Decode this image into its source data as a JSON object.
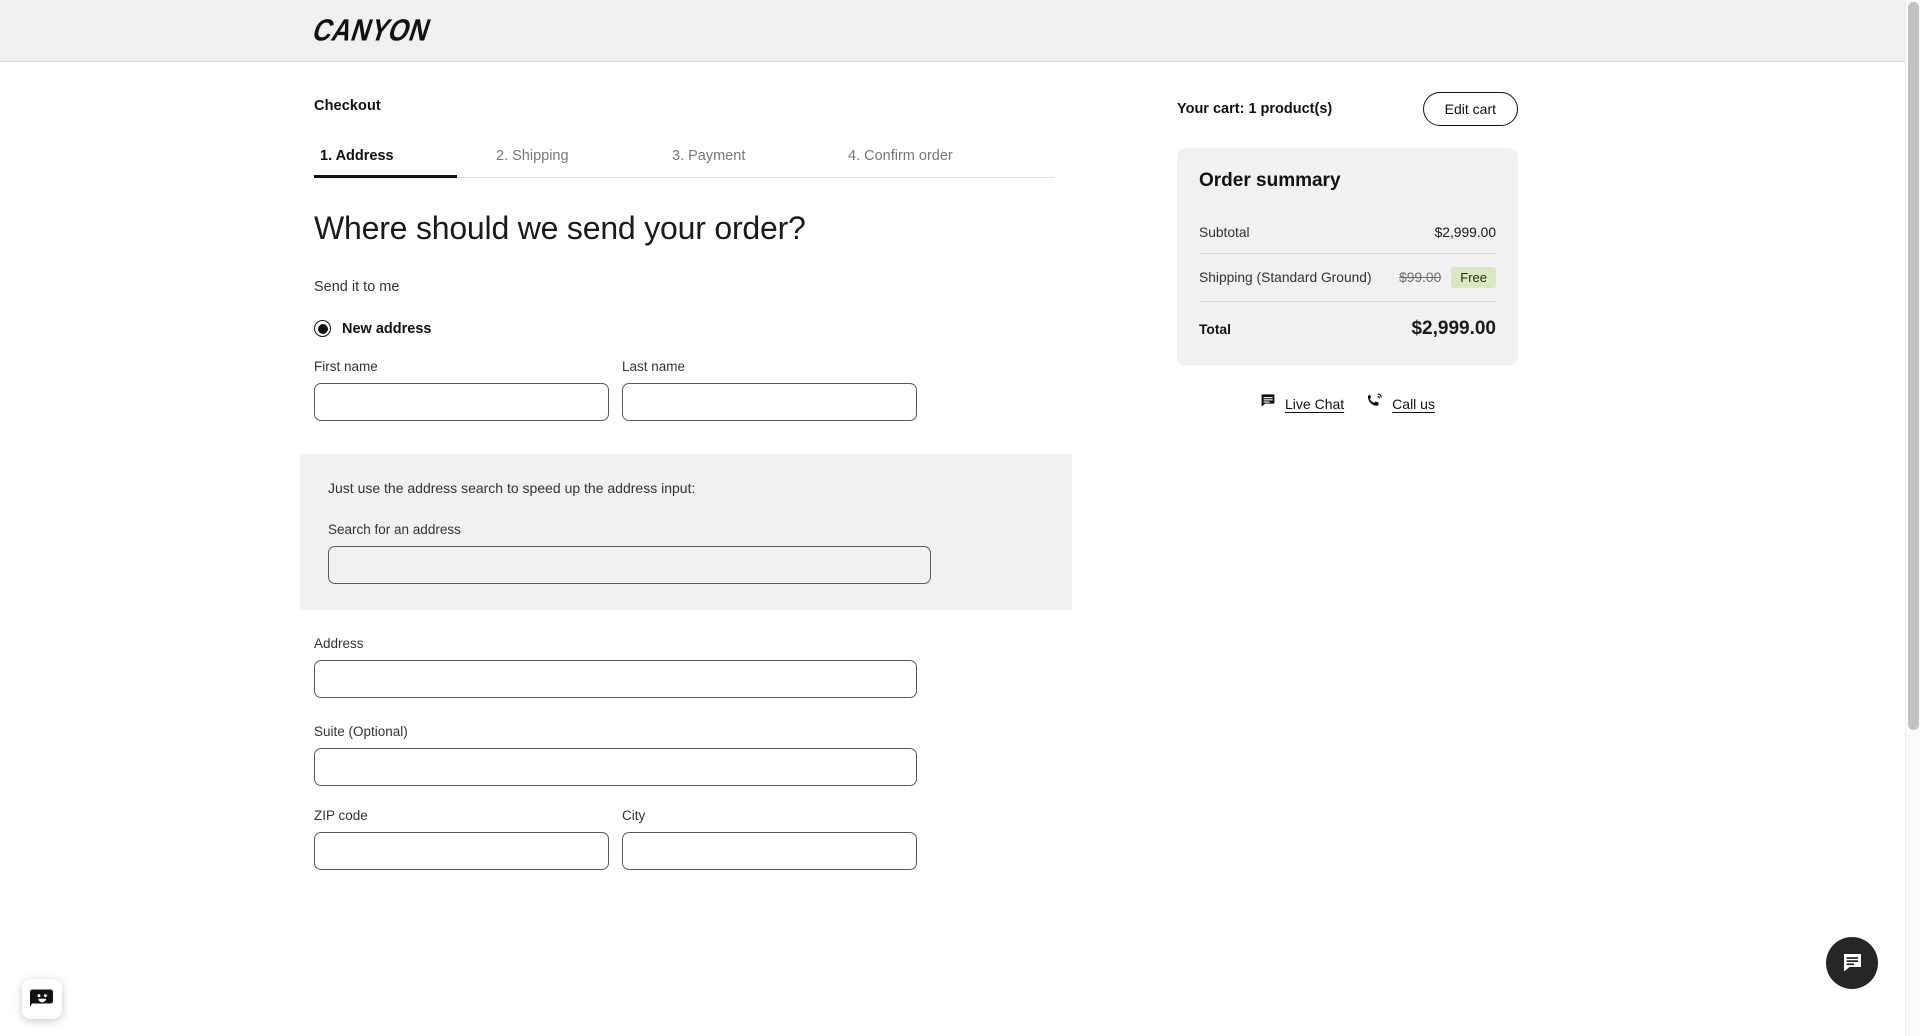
{
  "header": {
    "brand": "CANYON"
  },
  "checkout": {
    "title": "Checkout",
    "steps": [
      {
        "label": "1. Address",
        "active": true
      },
      {
        "label": "2. Shipping",
        "active": false
      },
      {
        "label": "3. Payment",
        "active": false
      },
      {
        "label": "4. Confirm order",
        "active": false
      }
    ],
    "headline": "Where should we send your order?",
    "subhead": "Send it to me",
    "address_option": {
      "label": "New address",
      "selected": true
    },
    "fields": {
      "first_name": {
        "label": "First name",
        "value": "",
        "placeholder": ""
      },
      "last_name": {
        "label": "Last name",
        "value": "",
        "placeholder": ""
      },
      "address": {
        "label": "Address",
        "value": "",
        "placeholder": ""
      },
      "suite": {
        "label": "Suite (Optional)",
        "value": "",
        "placeholder": ""
      },
      "zip": {
        "label": "ZIP code",
        "value": "",
        "placeholder": ""
      },
      "city": {
        "label": "City",
        "value": "",
        "placeholder": ""
      }
    },
    "address_search": {
      "note": "Just use the address search to speed up the address input:",
      "label": "Search for an address",
      "value": "",
      "placeholder": ""
    }
  },
  "cart": {
    "label": "Your cart: 1 product(s)",
    "edit_button": "Edit cart"
  },
  "summary": {
    "title": "Order summary",
    "rows": [
      {
        "label": "Subtotal",
        "value": "$2,999.00"
      },
      {
        "label": "Shipping (Standard Ground)",
        "original": "$99.00",
        "badge": "Free"
      }
    ],
    "total": {
      "label": "Total",
      "value": "$2,999.00"
    }
  },
  "support": {
    "live_chat": "Live Chat",
    "call_us": "Call us"
  },
  "colors": {
    "accent": "#111111",
    "panel_gray": "#f1f1f1",
    "free_badge_bg": "#d9e8c0",
    "header_bg": "#f0f0f0"
  }
}
